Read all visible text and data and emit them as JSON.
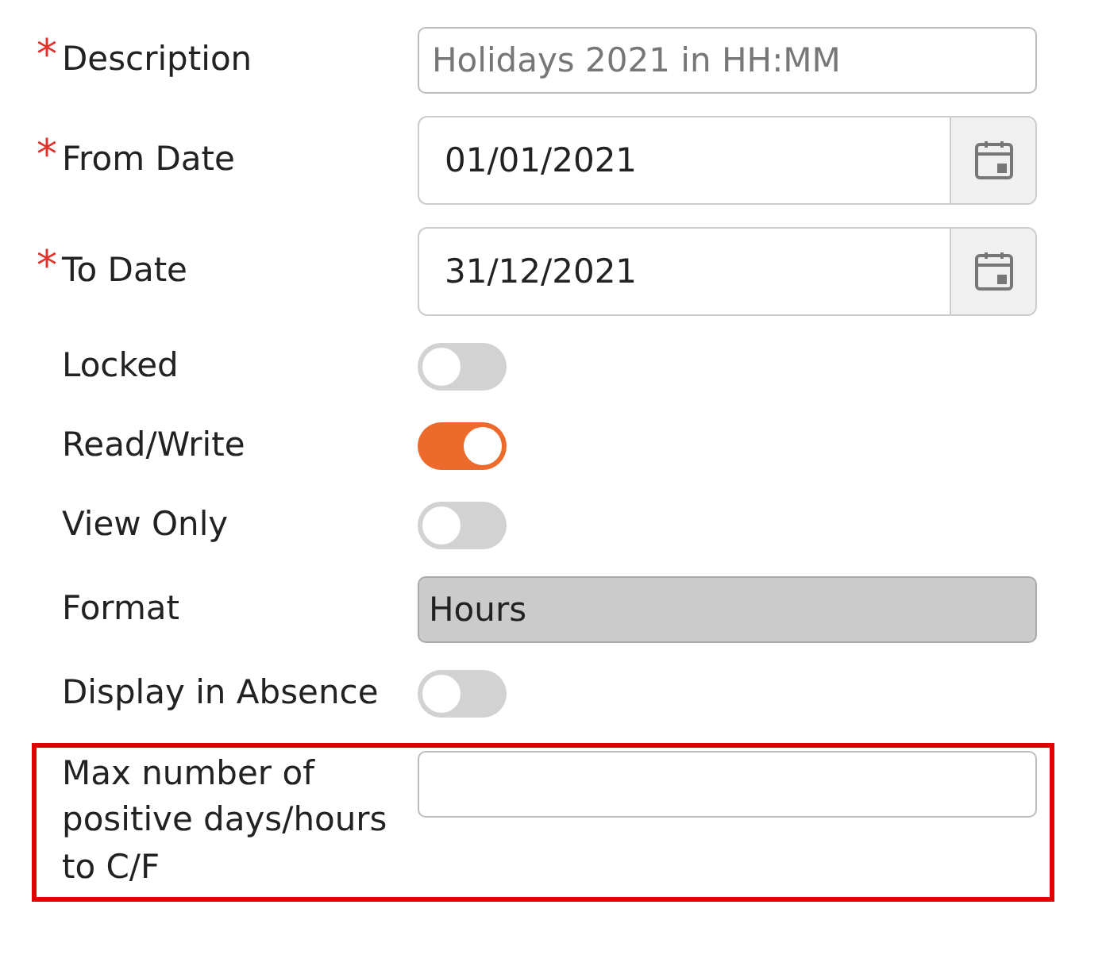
{
  "fields": [
    {
      "kind": "text",
      "label": "Description",
      "asterisk": "*",
      "placeholder": "Holidays 2021 in HH:MM"
    },
    {
      "kind": "date",
      "label": "From Date",
      "asterisk": "*",
      "value": "01/01/2021"
    },
    {
      "kind": "date",
      "label": "To Date",
      "asterisk": "*",
      "value": "31/12/2021"
    },
    {
      "kind": "toggle",
      "label": "Locked",
      "on": false
    },
    {
      "kind": "toggle",
      "label": "Read/Write",
      "on": true
    },
    {
      "kind": "toggle",
      "label": "View Only",
      "on": false
    },
    {
      "kind": "readonly",
      "label": "Format",
      "value": "Hours"
    },
    {
      "kind": "toggle",
      "label": "Display in Absence",
      "on": false
    },
    {
      "kind": "text",
      "label": "Max number of positive days/hours to C/F",
      "highlighted": true
    }
  ]
}
